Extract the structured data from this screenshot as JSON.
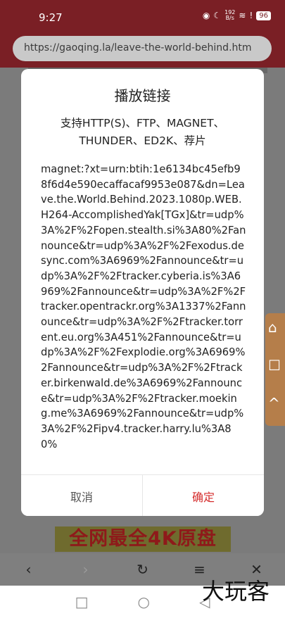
{
  "status_bar": {
    "time": "9:27",
    "net_speed_value": "192",
    "net_speed_unit": "B/s",
    "battery": "96"
  },
  "browser": {
    "url": "https://gaoqing.la/leave-the-world-behind.htm"
  },
  "modal": {
    "title": "播放链接",
    "subtitle": "支持HTTP(S)、FTP、MAGNET、THUNDER、ED2K、荐片",
    "magnet_link": "magnet:?xt=urn:btih:1e6134bc45efb98f6d4e590ecaffacaf9953e087&dn=Leave.the.World.Behind.2023.1080p.WEB.H264-AccomplishedYak[TGx]&tr=udp%3A%2F%2Fopen.stealth.si%3A80%2Fannounce&tr=udp%3A%2F%2Fexodus.desync.com%3A6969%2Fannounce&tr=udp%3A%2F%2Ftracker.cyberia.is%3A6969%2Fannounce&tr=udp%3A%2F%2Ftracker.opentrackr.org%3A1337%2Fannounce&tr=udp%3A%2F%2Ftracker.torrent.eu.org%3A451%2Fannounce&tr=udp%3A%2F%2Fexplodie.org%3A6969%2Fannounce&tr=udp%3A%2F%2Ftracker.birkenwald.de%3A6969%2Fannounce&tr=udp%3A%2F%2Ftracker.moeking.me%3A6969%2Fannounce&tr=udp%3A%2F%2Fipv4.tracker.harry.lu%3A80%",
    "cancel_label": "取消",
    "confirm_label": "确定"
  },
  "page": {
    "banner_text": "全网最全4K原盘"
  },
  "watermark": "大玩客",
  "colors": {
    "status_bar": "#7a1f25",
    "confirm_text": "#d42d2d",
    "side_tools": "#b57e4a"
  }
}
